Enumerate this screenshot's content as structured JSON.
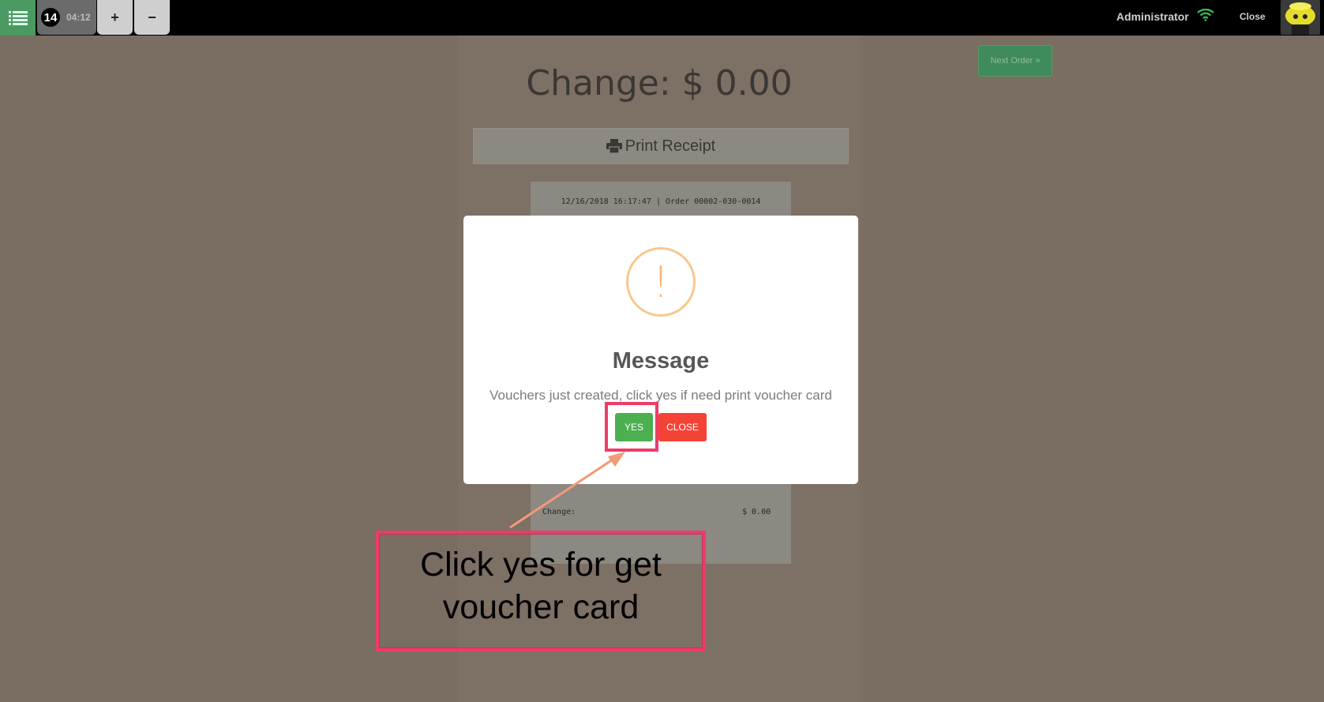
{
  "topbar": {
    "order_number": "14",
    "order_time": "04:12",
    "plus_label": "+",
    "minus_label": "−",
    "user_name": "Administrator",
    "close_label": "Close",
    "icons": [
      "list-icon",
      "wifi-icon",
      "avatar"
    ]
  },
  "page": {
    "next_order_label": "Next Order »",
    "change_title": "Change: $ 0.00",
    "print_label": "Print Receipt",
    "receipt": {
      "header": "12/16/2018 16:17:47 | Order 00002-030-0014",
      "change_label": "Change:",
      "change_value": "$ 0.00"
    }
  },
  "modal": {
    "icon": "exclamation",
    "title": "Message",
    "text": "Vouchers just created, click yes if need print voucher card",
    "yes_label": "YES",
    "close_label": "CLOSE"
  },
  "annotation": {
    "callout_line1": "Click yes for get",
    "callout_line2": "voucher card"
  },
  "colors": {
    "overlay_bg": "#7a6d62",
    "topbar_bg": "#000000",
    "menu_green": "#4a9a62",
    "yes_green": "#4caf50",
    "close_red": "#f44336",
    "warning_orange": "#f8c88d",
    "annotation_pink": "#ef3b67",
    "arrow_salmon": "#f39a78"
  }
}
